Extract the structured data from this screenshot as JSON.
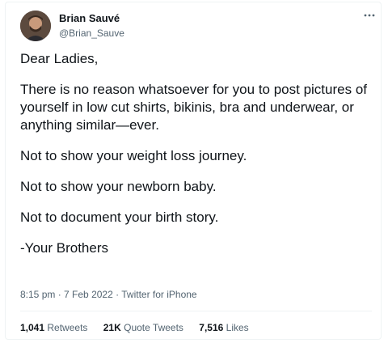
{
  "author": {
    "name": "Brian Sauvé",
    "handle": "@Brian_Sauve"
  },
  "tweet": {
    "paragraphs": [
      "Dear Ladies,",
      "There is no reason whatsoever for you to post pictures of yourself in low cut shirts, bikinis, bra and underwear, or anything similar—ever.",
      "Not to show your weight loss journey.",
      "Not to show your newborn baby.",
      "Not to document your birth story.",
      "-Your Brothers"
    ]
  },
  "meta": {
    "time": "8:15 pm",
    "separator": "·",
    "date": "7 Feb 2022",
    "source": "Twitter for iPhone"
  },
  "stats": {
    "retweets_count": "1,041",
    "retweets_label": "Retweets",
    "quotes_count": "21K",
    "quotes_label": "Quote Tweets",
    "likes_count": "7,516",
    "likes_label": "Likes"
  },
  "icons": {
    "more": "more-horizontal-icon"
  },
  "colors": {
    "text": "#0f1419",
    "secondary": "#536471",
    "divider": "#eff3f4"
  }
}
